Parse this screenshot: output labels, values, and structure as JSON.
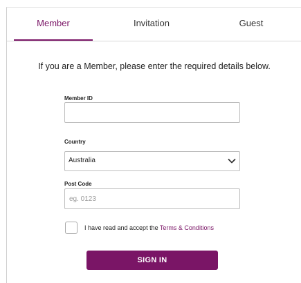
{
  "tabs": [
    {
      "label": "Member",
      "active": true
    },
    {
      "label": "Invitation",
      "active": false
    },
    {
      "label": "Guest",
      "active": false
    }
  ],
  "intro": "If you are a Member, please enter the required details below.",
  "form": {
    "member_id": {
      "label": "Member ID",
      "value": "",
      "placeholder": ""
    },
    "country": {
      "label": "Country",
      "value": "Australia"
    },
    "post_code": {
      "label": "Post Code",
      "value": "",
      "placeholder": "eg. 0123"
    },
    "terms": {
      "checked": false,
      "text": "I have read and accept the ",
      "link": "Terms & Conditions"
    },
    "submit_label": "SIGN IN"
  },
  "colors": {
    "accent": "#7a1566",
    "border": "#bdbdbd",
    "text": "#222222"
  }
}
